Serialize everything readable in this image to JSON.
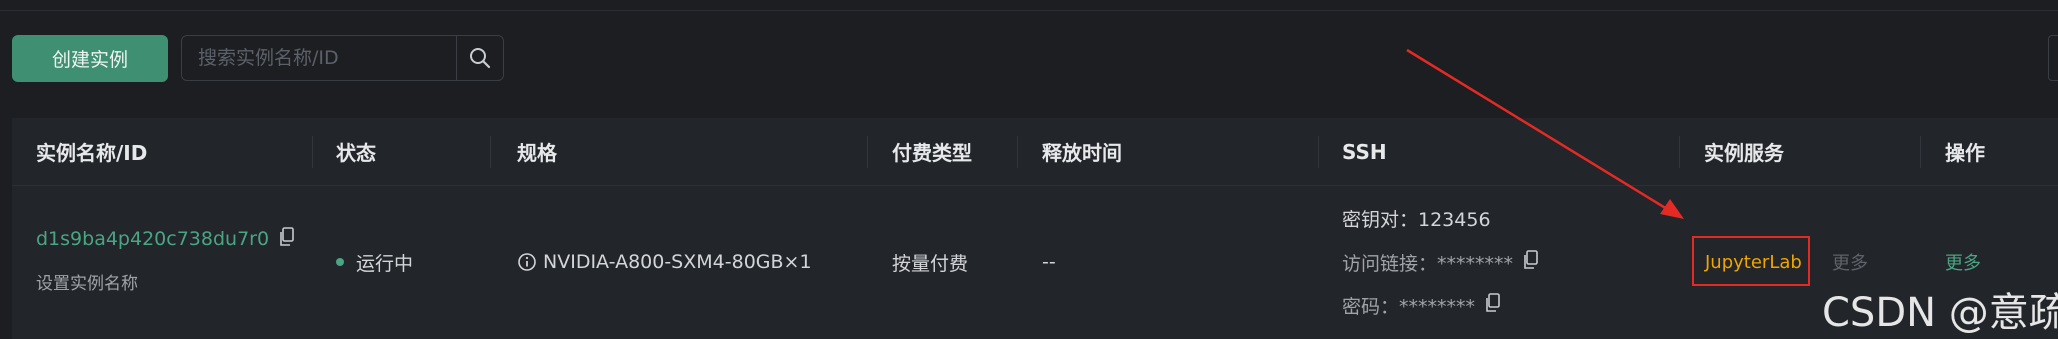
{
  "toolbar": {
    "create_label": "创建实例",
    "search_placeholder": "搜索实例名称/ID"
  },
  "table": {
    "headers": [
      "实例名称/ID",
      "状态",
      "规格",
      "付费类型",
      "释放时间",
      "SSH",
      "实例服务",
      "操作"
    ],
    "row": {
      "instance_id": "d1s9ba4p420c738du7r0",
      "set_name_label": "设置实例名称",
      "status": "运行中",
      "spec": "NVIDIA-A800-SXM4-80GB×1",
      "billing": "按量付费",
      "release_time": "--",
      "ssh_keypair": "密钥对：123456",
      "ssh_access": "访问链接：********",
      "ssh_password": "密码：********",
      "service_link": "JupyterLab",
      "service_more": "更多",
      "action_more": "更多"
    }
  },
  "watermark": "CSDN @意疏",
  "colors": {
    "accent": "#3f8f73",
    "link_green": "#4aa583",
    "service_link": "#f0a500",
    "annotation_red": "#e32a24"
  }
}
